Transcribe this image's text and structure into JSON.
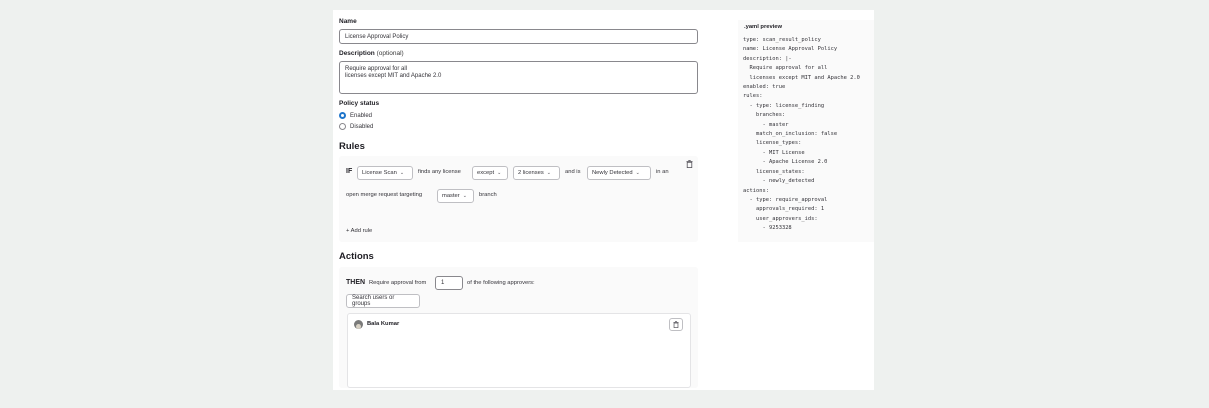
{
  "form": {
    "name_label": "Name",
    "name_value": "License Approval Policy",
    "description_label": "Description",
    "description_optional": "(optional)",
    "description_value": "Require approval for all\nlicenses except MIT and Apache 2.0",
    "status_label": "Policy status",
    "status_options": [
      {
        "label": "Enabled",
        "selected": true
      },
      {
        "label": "Disabled",
        "selected": false
      }
    ]
  },
  "rules": {
    "heading": "Rules",
    "if_keyword": "IF",
    "scanner": "License Scan",
    "finds_text": "finds any license",
    "match_select": "except",
    "licenses_select": "2 licenses",
    "and_is_text": "and is",
    "state_select": "Newly Detected",
    "in_an_text": "in an",
    "targeting_text": "open merge request targeting",
    "branch_select": "master",
    "branch_text": "branch",
    "add_rule_label": "+ Add rule"
  },
  "actions": {
    "heading": "Actions",
    "then_keyword": "THEN",
    "require_text": "Require approval from",
    "approvals_value": "1",
    "following_text": "of the following approvers:",
    "search_placeholder": "Search users or groups",
    "approvers": [
      {
        "name": "Bala Kumar"
      }
    ]
  },
  "yaml": {
    "title": ".yaml preview",
    "code": "type: scan_result_policy\nname: License Approval Policy\ndescription: |-\n  Require approval for all\n  licenses except MIT and Apache 2.0\nenabled: true\nrules:\n  - type: license_finding\n    branches:\n      - master\n    match_on_inclusion: false\n    license_types:\n      - MIT License\n      - Apache License 2.0\n    license_states:\n      - newly_detected\nactions:\n  - type: require_approval\n    approvals_required: 1\n    user_approvers_ids:\n      - 9253328"
  },
  "icons": {
    "trash": "trash-icon",
    "chevron": "chevron-down-icon",
    "avatar": "avatar"
  },
  "colors": {
    "accent": "#1f75cb",
    "background": "#eef1ef",
    "panel": "#ffffff",
    "muted_panel": "#fafafa"
  }
}
